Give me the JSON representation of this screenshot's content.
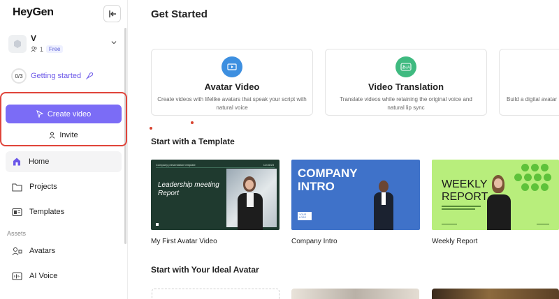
{
  "app": {
    "logo": "HeyGen"
  },
  "workspace": {
    "name": "V",
    "members": "1",
    "plan": "Free"
  },
  "onboarding": {
    "progress": "0/3",
    "label": "Getting started"
  },
  "actions": {
    "create_video": "Create video",
    "invite": "Invite"
  },
  "nav": {
    "items": [
      {
        "label": "Home",
        "icon": "home-icon"
      },
      {
        "label": "Projects",
        "icon": "folder-icon"
      },
      {
        "label": "Templates",
        "icon": "templates-icon"
      }
    ],
    "assets_label": "Assets",
    "assets": [
      {
        "label": "Avatars",
        "icon": "avatars-icon"
      },
      {
        "label": "AI Voice",
        "icon": "voice-icon"
      }
    ]
  },
  "main": {
    "title": "Get Started",
    "cards": [
      {
        "title": "Avatar Video",
        "desc": "Create videos with lifelike avatars that speak your script with natural voice",
        "icon": "video-icon",
        "color": "#3d8fe0"
      },
      {
        "title": "Video Translation",
        "desc": "Translate videos while retaining the original voice and natural lip sync",
        "icon": "translate-icon",
        "color": "#3fba80"
      },
      {
        "title": "",
        "desc": "Build a digital avatar",
        "icon": "",
        "color": ""
      }
    ],
    "template_section": "Start with a Template",
    "templates": [
      {
        "caption": "My First Avatar Video",
        "thumb_title": "Leadership meeting Report",
        "thumb_header": "Company presentation template",
        "thumb_date": "11/16/23"
      },
      {
        "caption": "Company Intro",
        "thumb_title_1": "COMPANY",
        "thumb_title_2": "INTRO",
        "thumb_logo": "YOUR LOGO"
      },
      {
        "caption": "Weekly Report",
        "thumb_title_1": "WEEKLY",
        "thumb_title_2": "REPORT"
      }
    ],
    "avatar_section": "Start with Your Ideal Avatar"
  }
}
